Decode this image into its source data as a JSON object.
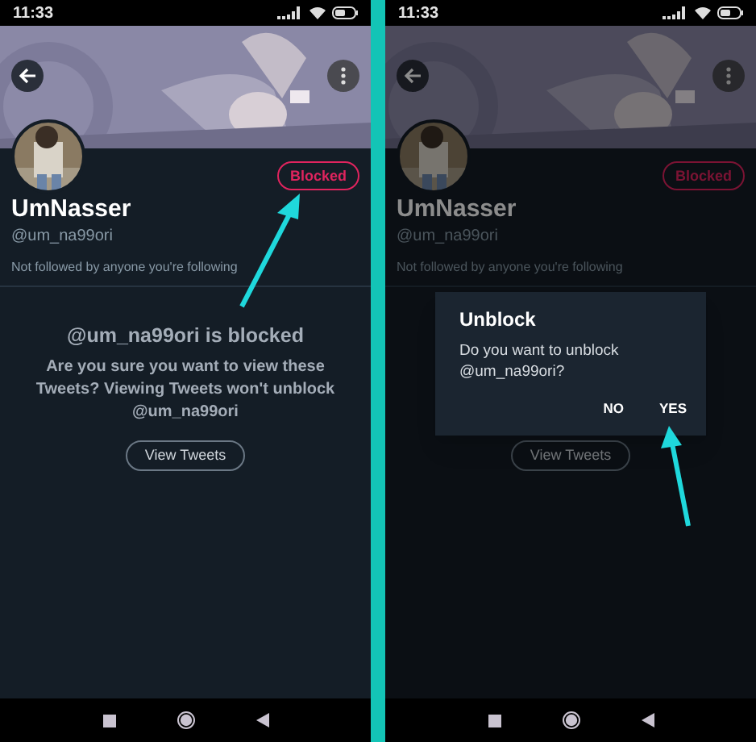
{
  "screens": [
    {
      "status_time": "11:33",
      "profile": {
        "name": "UmNasser",
        "handle": "@um_na99ori",
        "follow_note": "Not followed by anyone you're following",
        "blocked_label": "Blocked"
      },
      "blocked_notice": {
        "title": "@um_na99ori is blocked",
        "message": "Are you sure you want to view these Tweets? Viewing Tweets won't unblock @um_na99ori",
        "button": "View Tweets"
      }
    },
    {
      "status_time": "11:33",
      "profile": {
        "name": "UmNasser",
        "handle": "@um_na99ori",
        "follow_note": "Not followed by anyone you're following",
        "blocked_label": "Blocked"
      },
      "blocked_notice": {
        "button": "View Tweets"
      },
      "dialog": {
        "title": "Unblock",
        "message": "Do you want to unblock @um_na99ori?",
        "buttons": [
          "NO",
          "YES"
        ]
      }
    }
  ]
}
